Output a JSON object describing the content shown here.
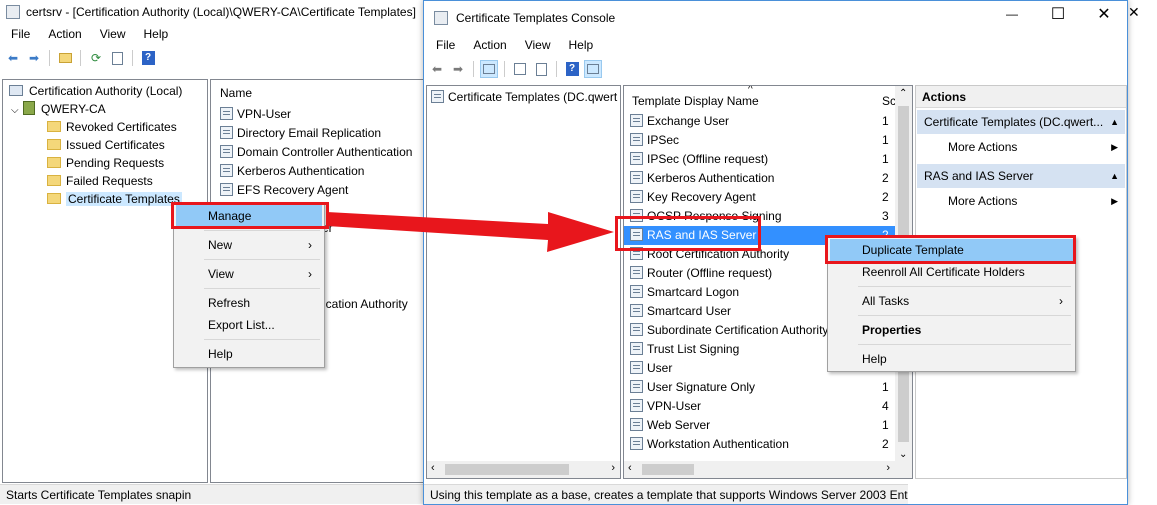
{
  "bg_window": {
    "title": "certsrv - [Certification Authority (Local)\\QWERY-CA\\Certificate Templates]",
    "menu": [
      "File",
      "Action",
      "View",
      "Help"
    ],
    "tree": [
      {
        "label": "Certification Authority (Local)"
      },
      {
        "label": "QWERY-CA"
      },
      {
        "label": "Revoked Certificates"
      },
      {
        "label": "Issued Certificates"
      },
      {
        "label": "Pending Requests"
      },
      {
        "label": "Failed Requests"
      },
      {
        "label": "Certificate Templates"
      }
    ],
    "list_header": "Name",
    "list_items": [
      "VPN-User",
      "Directory Email Replication",
      "Domain Controller Authentication",
      "Kerberos Authentication",
      "EFS Recovery Agent"
    ],
    "partial_item_1": "er",
    "partial_item_2": "ification Authority",
    "status": "Starts Certificate Templates snapin",
    "close_glyph": "✕"
  },
  "context_menu_left": {
    "items": [
      "Manage",
      "New",
      "View",
      "Refresh",
      "Export List...",
      "Help"
    ],
    "submenu_arrow": "›"
  },
  "console": {
    "title": "Certificate Templates Console",
    "menu": [
      "File",
      "Action",
      "View",
      "Help"
    ],
    "tree_item": "Certificate Templates (DC.qwert",
    "column_name": "Template Display Name",
    "column_schema": "Sc",
    "templates": [
      {
        "name": "Exchange User",
        "schema": "1"
      },
      {
        "name": "IPSec",
        "schema": "1"
      },
      {
        "name": "IPSec (Offline request)",
        "schema": "1"
      },
      {
        "name": "Kerberos Authentication",
        "schema": "2"
      },
      {
        "name": "Key Recovery Agent",
        "schema": "2"
      },
      {
        "name": "OCSP Response Signing",
        "schema": "3"
      },
      {
        "name": "RAS and IAS Server",
        "schema": "2"
      },
      {
        "name": "Root Certification Authority",
        "schema": ""
      },
      {
        "name": "Router (Offline request)",
        "schema": ""
      },
      {
        "name": "Smartcard Logon",
        "schema": ""
      },
      {
        "name": "Smartcard User",
        "schema": ""
      },
      {
        "name": "Subordinate Certification Authority",
        "schema": ""
      },
      {
        "name": "Trust List Signing",
        "schema": ""
      },
      {
        "name": "User",
        "schema": ""
      },
      {
        "name": "User Signature Only",
        "schema": "1"
      },
      {
        "name": "VPN-User",
        "schema": "4"
      },
      {
        "name": "Web Server",
        "schema": "1"
      },
      {
        "name": "Workstation Authentication",
        "schema": "2"
      }
    ],
    "actions": {
      "header": "Actions",
      "section1": "Certificate Templates (DC.qwert...",
      "section1_item": "More Actions",
      "section2": "RAS and IAS Server",
      "section2_item": "More Actions"
    },
    "status": "Using this template as a base, creates a template that supports Windows Server 2003 Enterp",
    "caption": {
      "minimize": "—",
      "maximize": "☐",
      "close": "✕"
    }
  },
  "context_menu_right": {
    "items": [
      "Duplicate Template",
      "Reenroll All Certificate Holders",
      "All Tasks",
      "Properties",
      "Help"
    ],
    "submenu_arrow": "›"
  },
  "annotation_color": "#e8161c"
}
